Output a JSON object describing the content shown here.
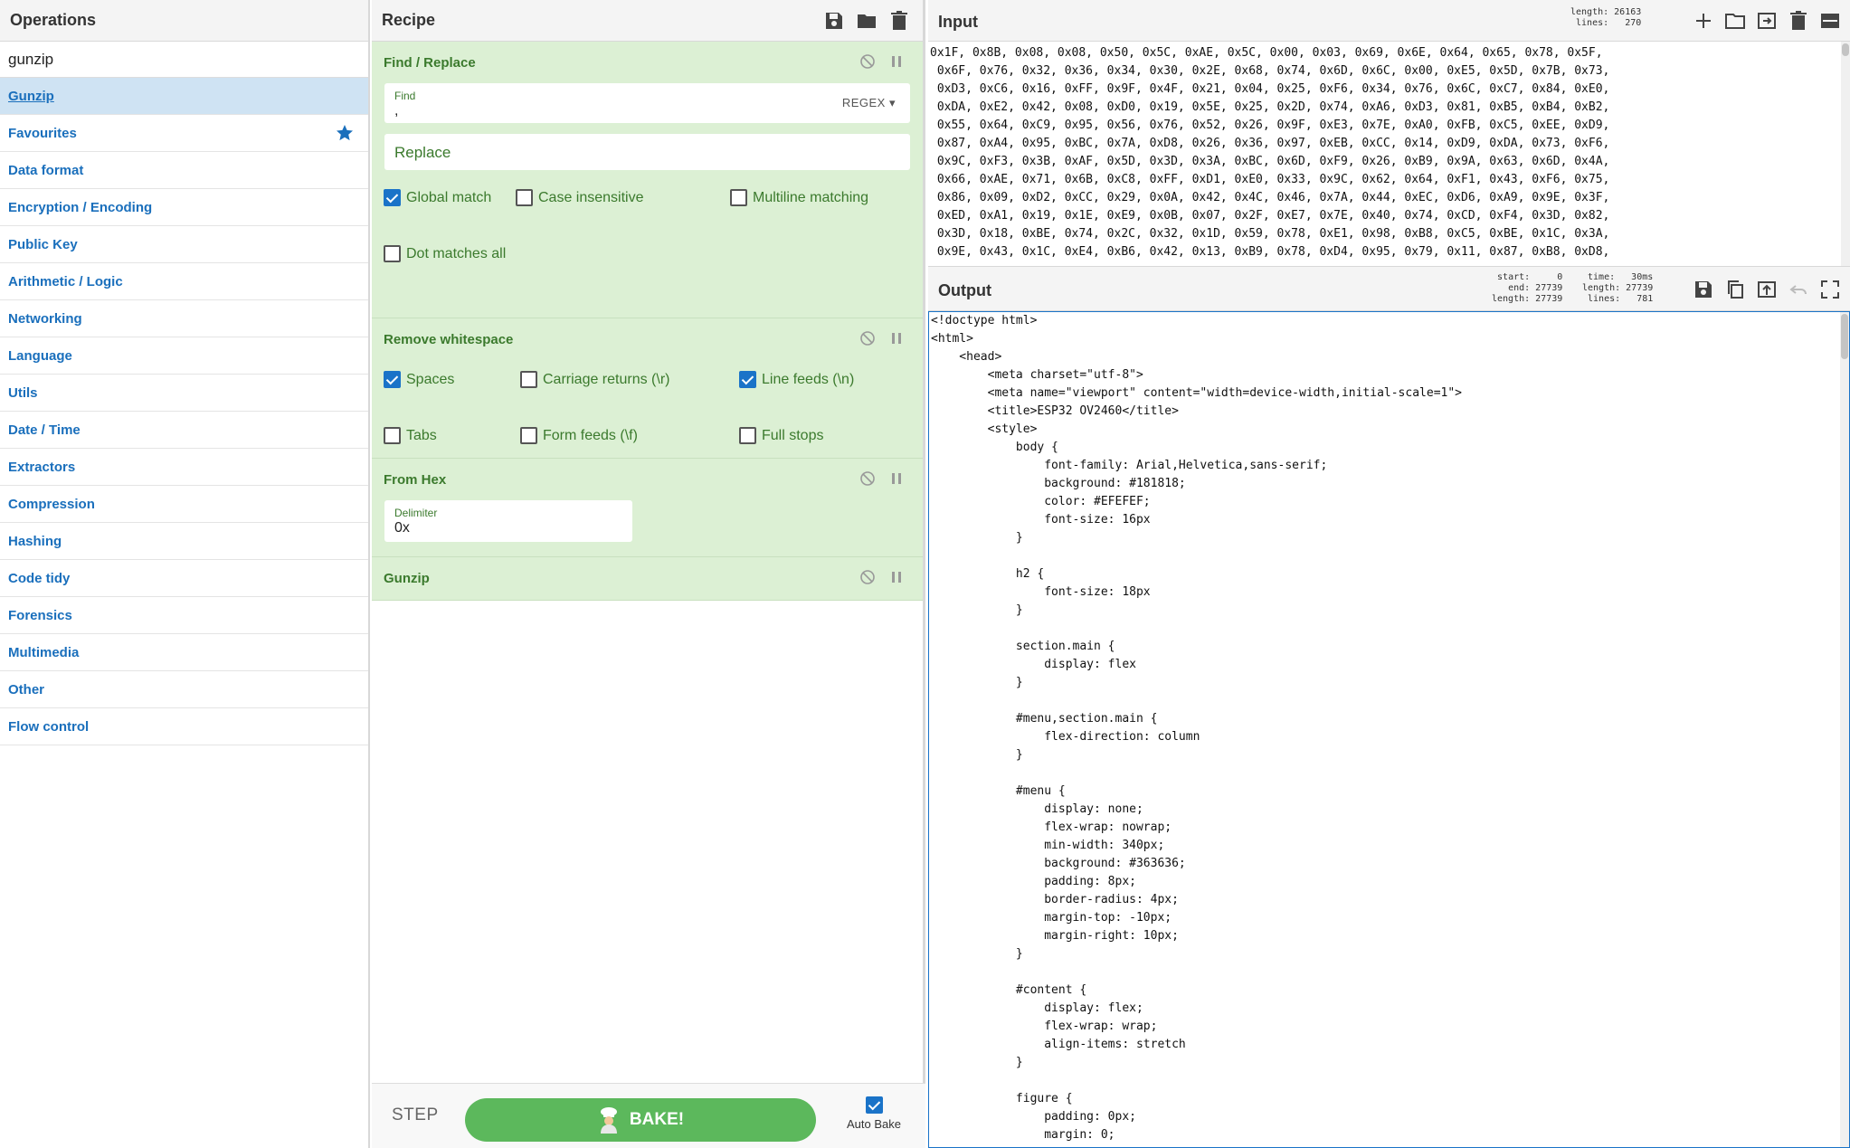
{
  "operations": {
    "title": "Operations",
    "search_value": "gunzip",
    "items": [
      {
        "label": "Gunzip"
      },
      {
        "label": "Favourites"
      },
      {
        "label": "Data format"
      },
      {
        "label": "Encryption / Encoding"
      },
      {
        "label": "Public Key"
      },
      {
        "label": "Arithmetic / Logic"
      },
      {
        "label": "Networking"
      },
      {
        "label": "Language"
      },
      {
        "label": "Utils"
      },
      {
        "label": "Date / Time"
      },
      {
        "label": "Extractors"
      },
      {
        "label": "Compression"
      },
      {
        "label": "Hashing"
      },
      {
        "label": "Code tidy"
      },
      {
        "label": "Forensics"
      },
      {
        "label": "Multimedia"
      },
      {
        "label": "Other"
      },
      {
        "label": "Flow control"
      }
    ]
  },
  "recipe": {
    "title": "Recipe",
    "find_replace": {
      "title": "Find / Replace",
      "find_label": "Find",
      "find_value": ",",
      "find_mode": "REGEX",
      "replace_placeholder": "Replace",
      "global_match": "Global match",
      "case_insensitive": "Case insensitive",
      "multiline": "Multiline matching",
      "dot_all": "Dot matches all"
    },
    "remove_whitespace": {
      "title": "Remove whitespace",
      "spaces": "Spaces",
      "carriage_returns": "Carriage returns (\\r)",
      "line_feeds": "Line feeds (\\n)",
      "tabs": "Tabs",
      "form_feeds": "Form feeds (\\f)",
      "full_stops": "Full stops"
    },
    "from_hex": {
      "title": "From Hex",
      "delimiter_label": "Delimiter",
      "delimiter_value": "0x"
    },
    "gunzip": {
      "title": "Gunzip"
    },
    "step_label": "STEP",
    "bake_label": "BAKE!",
    "auto_bake_label": "Auto Bake"
  },
  "input": {
    "title": "Input",
    "info_length": "length: 26163",
    "info_lines": " lines:   270",
    "lines": [
      "0x1F, 0x8B, 0x08, 0x08, 0x50, 0x5C, 0xAE, 0x5C, 0x00, 0x03, 0x69, 0x6E, 0x64, 0x65, 0x78, 0x5F,",
      " 0x6F, 0x76, 0x32, 0x36, 0x34, 0x30, 0x2E, 0x68, 0x74, 0x6D, 0x6C, 0x00, 0xE5, 0x5D, 0x7B, 0x73,",
      " 0xD3, 0xC6, 0x16, 0xFF, 0x9F, 0x4F, 0x21, 0x04, 0x25, 0xF6, 0x34, 0x76, 0x6C, 0xC7, 0x84, 0xE0,",
      " 0xDA, 0xE2, 0x42, 0x08, 0xD0, 0x19, 0x5E, 0x25, 0x2D, 0x74, 0xA6, 0xD3, 0x81, 0xB5, 0xB4, 0xB2,",
      " 0x55, 0x64, 0xC9, 0x95, 0x56, 0x76, 0x52, 0x26, 0x9F, 0xE3, 0x7E, 0xA0, 0xFB, 0xC5, 0xEE, 0xD9,",
      " 0x87, 0xA4, 0x95, 0xBC, 0x7A, 0xD8, 0x26, 0x36, 0x97, 0xEB, 0xCC, 0x14, 0xD9, 0xDA, 0x73, 0xF6,",
      " 0x9C, 0xF3, 0x3B, 0xAF, 0x5D, 0x3D, 0x3A, 0xBC, 0x6D, 0xF9, 0x26, 0xB9, 0x9A, 0x63, 0x6D, 0x4A,",
      " 0x66, 0xAE, 0x71, 0x6B, 0xC8, 0xFF, 0xD1, 0xE0, 0x33, 0x9C, 0x62, 0x64, 0xF1, 0x43, 0xF6, 0x75,",
      " 0x86, 0x09, 0xD2, 0xCC, 0x29, 0x0A, 0x42, 0x4C, 0x46, 0x7A, 0x44, 0xEC, 0xD6, 0xA9, 0x9E, 0x3F,",
      " 0xED, 0xA1, 0x19, 0x1E, 0xE9, 0x0B, 0x07, 0x2F, 0xE7, 0x7E, 0x40, 0x74, 0xCD, 0xF4, 0x3D, 0x82,",
      " 0x3D, 0x18, 0xBE, 0x74, 0x2C, 0x32, 0x1D, 0x59, 0x78, 0xE1, 0x98, 0xB8, 0xC5, 0xBE, 0x1C, 0x3A,",
      " 0x9E, 0x43, 0x1C, 0xE4, 0xB6, 0x42, 0x13, 0xB9, 0x78, 0xD4, 0x95, 0x79, 0x11, 0x87, 0xB8, 0xD8,"
    ]
  },
  "output": {
    "title": "Output",
    "info_col1": "start:     0\n  end: 27739\nlength: 27739",
    "info_col2": " time:   30ms\nlength: 27739\n lines:   781",
    "lines": [
      "<!doctype html>",
      "<html>",
      "    <head>",
      "        <meta charset=\"utf-8\">",
      "        <meta name=\"viewport\" content=\"width=device-width,initial-scale=1\">",
      "        <title>ESP32 OV2460</title>",
      "        <style>",
      "            body {",
      "                font-family: Arial,Helvetica,sans-serif;",
      "                background: #181818;",
      "                color: #EFEFEF;",
      "                font-size: 16px",
      "            }",
      "",
      "            h2 {",
      "                font-size: 18px",
      "            }",
      "",
      "            section.main {",
      "                display: flex",
      "            }",
      "",
      "            #menu,section.main {",
      "                flex-direction: column",
      "            }",
      "",
      "            #menu {",
      "                display: none;",
      "                flex-wrap: nowrap;",
      "                min-width: 340px;",
      "                background: #363636;",
      "                padding: 8px;",
      "                border-radius: 4px;",
      "                margin-top: -10px;",
      "                margin-right: 10px;",
      "            }",
      "",
      "            #content {",
      "                display: flex;",
      "                flex-wrap: wrap;",
      "                align-items: stretch",
      "            }",
      "",
      "            figure {",
      "                padding: 0px;",
      "                margin: 0;"
    ]
  },
  "colors": {
    "accent_blue": "#1a73c8",
    "recipe_green_bg": "#dcf0d4",
    "recipe_green_text": "#3b7a2d",
    "bake_green": "#5cb85c",
    "selected_op_bg": "#cfe3f3"
  }
}
